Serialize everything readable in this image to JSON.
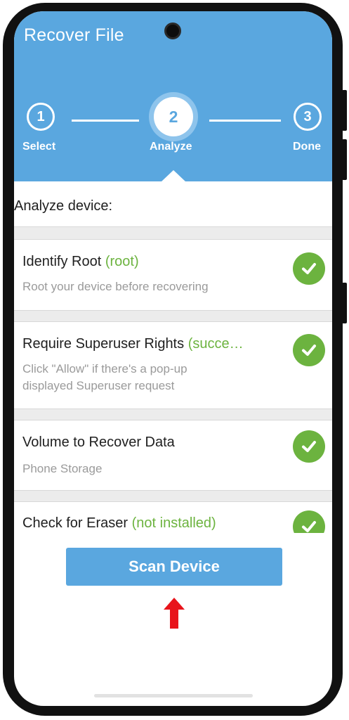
{
  "app": {
    "title": "Recover File"
  },
  "steps": [
    {
      "number": "1",
      "label": "Select"
    },
    {
      "number": "2",
      "label": "Analyze"
    },
    {
      "number": "3",
      "label": "Done"
    }
  ],
  "analyze": {
    "heading": "Analyze device:",
    "items": [
      {
        "title": "Identify Root",
        "status": "(root)",
        "desc1": "Root your device before recovering",
        "desc2": ""
      },
      {
        "title": "Require Superuser Rights",
        "status": "(succe…",
        "desc1": "Click \"Allow\" if there's a pop-up",
        "desc2": "displayed Superuser request"
      },
      {
        "title": "Volume to Recover Data",
        "status": "",
        "desc1": "Phone Storage",
        "desc2": ""
      },
      {
        "title": "Check for Eraser",
        "status": "(not installed)",
        "desc1": "",
        "desc2": ""
      }
    ]
  },
  "actions": {
    "scan_label": "Scan Device"
  },
  "icons": {
    "check": "checkmark-icon",
    "arrow": "arrow-up-icon",
    "camera": "camera-icon"
  },
  "colors": {
    "primary": "#5aa7df",
    "success": "#6cb33f",
    "arrow": "#e8141b"
  }
}
